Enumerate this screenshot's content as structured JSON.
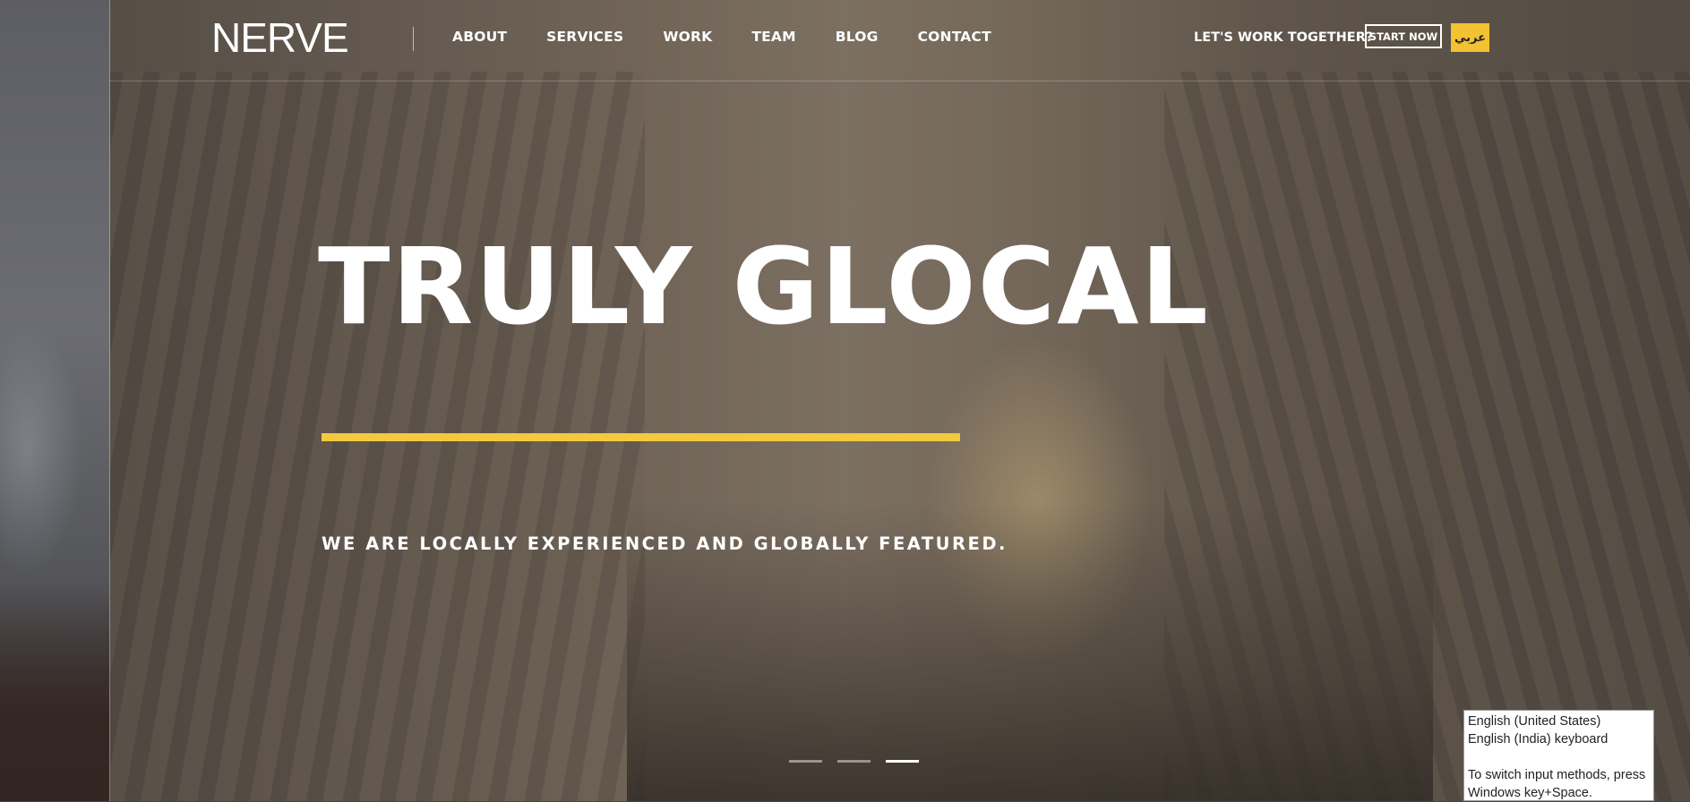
{
  "header": {
    "logo": "NERVE",
    "nav": [
      "ABOUT",
      "SERVICES",
      "WORK",
      "TEAM",
      "BLOG",
      "CONTACT"
    ],
    "cta_text": "LET'S WORK TOGETHER?",
    "start_button": "START NOW",
    "language_button": "عربي"
  },
  "hero": {
    "headline": "TRULY GLOCAL",
    "subline": "WE ARE LOCALLY EXPERIENCED AND GLOBALLY FEATURED.",
    "slides_total": 3,
    "active_slide": 3
  },
  "colors": {
    "accent": "#f3c93f"
  },
  "ime_popup": {
    "line1": "English (United States)",
    "line2": "English (India) keyboard",
    "line3": "To switch input methods, press",
    "line4": "Windows key+Space."
  }
}
